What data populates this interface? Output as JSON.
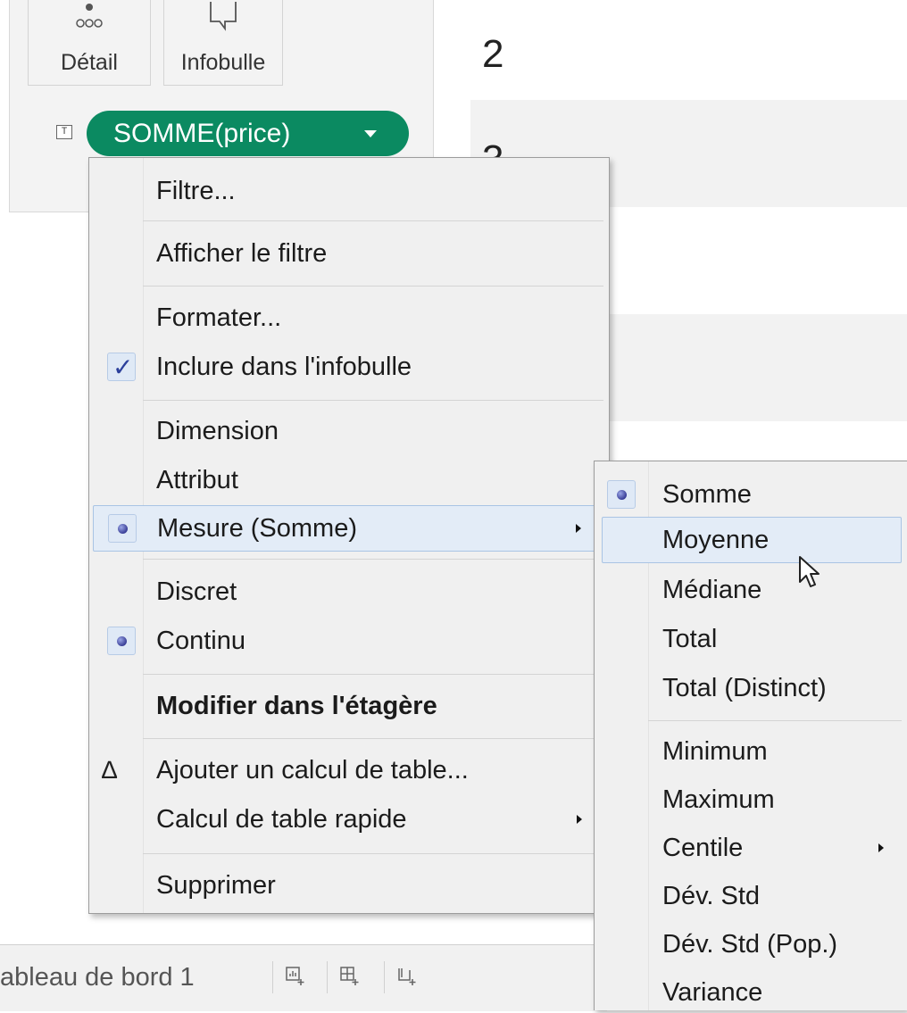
{
  "marks": {
    "detail_label": "Détail",
    "tooltip_label": "Infobulle",
    "text_icon_glyph": "T",
    "pill_label": "SOMME(price)"
  },
  "sheet": {
    "row_numbers": [
      "2",
      "3"
    ]
  },
  "context_menu": {
    "items": [
      {
        "label": "Filtre..."
      },
      {
        "label": "Afficher le filtre"
      },
      {
        "label": "Formater..."
      },
      {
        "label": "Inclure dans l'infobulle",
        "checked": true
      },
      {
        "label": "Dimension"
      },
      {
        "label": "Attribut"
      },
      {
        "label": "Mesure (Somme)",
        "selected": true,
        "submenu": true,
        "highlighted": true
      },
      {
        "label": "Discret"
      },
      {
        "label": "Continu",
        "selected": true
      },
      {
        "label": "Modifier dans l'étagère",
        "bold": true
      },
      {
        "label": "Ajouter un calcul de table...",
        "icon": "delta-icon"
      },
      {
        "label": "Calcul de table rapide",
        "submenu": true
      },
      {
        "label": "Supprimer"
      }
    ]
  },
  "measure_submenu": {
    "items": [
      {
        "label": "Somme",
        "selected": true
      },
      {
        "label": "Moyenne",
        "hovered": true
      },
      {
        "label": "Médiane"
      },
      {
        "label": "Total"
      },
      {
        "label": "Total (Distinct)"
      },
      {
        "label": "Minimum"
      },
      {
        "label": "Maximum"
      },
      {
        "label": "Centile",
        "submenu": true
      },
      {
        "label": "Dév. Std"
      },
      {
        "label": "Dév. Std (Pop.)"
      },
      {
        "label": "Variance"
      }
    ]
  },
  "tabs": {
    "dashboard_tab": "ableau de bord 1",
    "icons": [
      "new-worksheet-icon",
      "new-dashboard-icon",
      "new-story-icon"
    ]
  },
  "colors": {
    "pill_green": "#0b8a61",
    "menu_bg": "#f0f0f0",
    "highlight_bg": "#e3ecf7",
    "highlight_border": "#a9c4e4",
    "check_blue": "#2b3f9b"
  }
}
